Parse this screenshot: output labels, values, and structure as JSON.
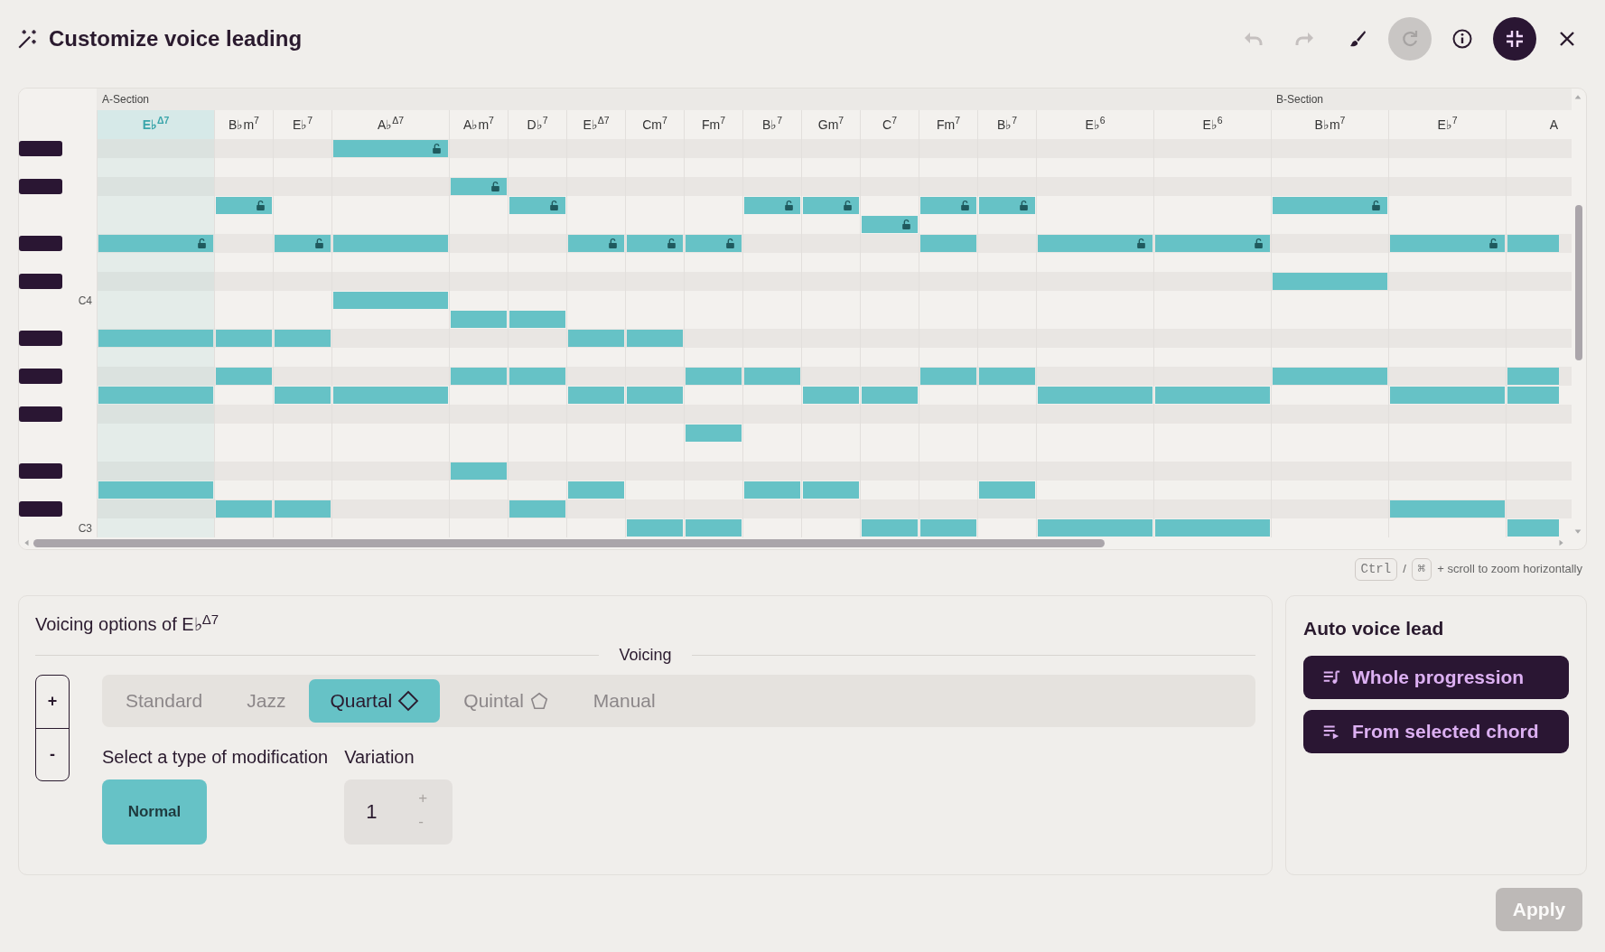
{
  "window": {
    "title": "Customize voice leading"
  },
  "toolbar": [
    {
      "kind": "undo",
      "disabled": true
    },
    {
      "kind": "redo",
      "disabled": true
    },
    {
      "kind": "brush",
      "disabled": false
    },
    {
      "kind": "refresh",
      "disabled": true
    },
    {
      "kind": "info",
      "disabled": false
    },
    {
      "kind": "collapse",
      "disabled": false
    },
    {
      "kind": "close",
      "disabled": false
    }
  ],
  "keyboard": [
    {
      "kind": "black_key"
    },
    {
      "kind": "white_key"
    },
    {
      "kind": "black_key"
    },
    {
      "kind": "white_key"
    },
    {
      "kind": "white_key"
    },
    {
      "kind": "black_key"
    },
    {
      "kind": "white_key"
    },
    {
      "kind": "black_key"
    },
    {
      "kind": "white_key",
      "label": "C4"
    },
    {
      "kind": "white_key"
    },
    {
      "kind": "black_key"
    },
    {
      "kind": "white_key"
    },
    {
      "kind": "black_key"
    },
    {
      "kind": "white_key"
    },
    {
      "kind": "black_key"
    },
    {
      "kind": "white_key"
    },
    {
      "kind": "white_key"
    },
    {
      "kind": "black_key"
    },
    {
      "kind": "white_key"
    },
    {
      "kind": "black_key"
    },
    {
      "kind": "white_key",
      "label": "C3"
    }
  ],
  "chords": [
    {
      "name": "E♭$^{Δ7}$",
      "kind": "wide",
      "selected": true,
      "section": "A-Section",
      "cells": [
        {
          "kind": "rest"
        },
        {
          "kind": "rest"
        },
        {
          "kind": "rest"
        },
        {
          "kind": "rest"
        },
        {
          "kind": "rest"
        },
        {
          "kind": "locked_note"
        },
        {
          "kind": "rest"
        },
        {
          "kind": "rest"
        },
        {
          "kind": "rest"
        },
        {
          "kind": "rest"
        },
        {
          "kind": "note"
        },
        {
          "kind": "rest"
        },
        {
          "kind": "rest"
        },
        {
          "kind": "note"
        },
        {
          "kind": "rest"
        },
        {
          "kind": "rest"
        },
        {
          "kind": "rest"
        },
        {
          "kind": "rest"
        },
        {
          "kind": "note"
        },
        {
          "kind": "rest"
        },
        {
          "kind": "rest"
        }
      ]
    },
    {
      "name": "B♭m$^{7}$",
      "kind": "narrow",
      "selected": false,
      "cells": [
        {
          "kind": "rest"
        },
        {
          "kind": "rest"
        },
        {
          "kind": "rest"
        },
        {
          "kind": "locked_note"
        },
        {
          "kind": "rest"
        },
        {
          "kind": "rest"
        },
        {
          "kind": "rest"
        },
        {
          "kind": "rest"
        },
        {
          "kind": "rest"
        },
        {
          "kind": "rest"
        },
        {
          "kind": "note"
        },
        {
          "kind": "rest"
        },
        {
          "kind": "note"
        },
        {
          "kind": "rest"
        },
        {
          "kind": "rest"
        },
        {
          "kind": "rest"
        },
        {
          "kind": "rest"
        },
        {
          "kind": "rest"
        },
        {
          "kind": "rest"
        },
        {
          "kind": "note"
        },
        {
          "kind": "rest"
        }
      ]
    },
    {
      "name": "E♭$^{7}$",
      "kind": "narrow",
      "selected": false,
      "cells": [
        {
          "kind": "rest"
        },
        {
          "kind": "rest"
        },
        {
          "kind": "rest"
        },
        {
          "kind": "rest"
        },
        {
          "kind": "rest"
        },
        {
          "kind": "locked_note"
        },
        {
          "kind": "rest"
        },
        {
          "kind": "rest"
        },
        {
          "kind": "rest"
        },
        {
          "kind": "rest"
        },
        {
          "kind": "note"
        },
        {
          "kind": "rest"
        },
        {
          "kind": "rest"
        },
        {
          "kind": "note"
        },
        {
          "kind": "rest"
        },
        {
          "kind": "rest"
        },
        {
          "kind": "rest"
        },
        {
          "kind": "rest"
        },
        {
          "kind": "rest"
        },
        {
          "kind": "note"
        },
        {
          "kind": "rest"
        }
      ]
    },
    {
      "name": "A♭$^{Δ7}$",
      "kind": "wide",
      "selected": false,
      "cells": [
        {
          "kind": "locked_note"
        },
        {
          "kind": "rest"
        },
        {
          "kind": "rest"
        },
        {
          "kind": "rest"
        },
        {
          "kind": "rest"
        },
        {
          "kind": "note"
        },
        {
          "kind": "rest"
        },
        {
          "kind": "rest"
        },
        {
          "kind": "note"
        },
        {
          "kind": "rest"
        },
        {
          "kind": "rest"
        },
        {
          "kind": "rest"
        },
        {
          "kind": "rest"
        },
        {
          "kind": "note"
        },
        {
          "kind": "rest"
        },
        {
          "kind": "rest"
        },
        {
          "kind": "rest"
        },
        {
          "kind": "rest"
        },
        {
          "kind": "rest"
        },
        {
          "kind": "rest"
        },
        {
          "kind": "rest"
        }
      ]
    },
    {
      "name": "A♭m$^{7}$",
      "kind": "narrow",
      "selected": false,
      "cells": [
        {
          "kind": "rest"
        },
        {
          "kind": "rest"
        },
        {
          "kind": "locked_note"
        },
        {
          "kind": "rest"
        },
        {
          "kind": "rest"
        },
        {
          "kind": "rest"
        },
        {
          "kind": "rest"
        },
        {
          "kind": "rest"
        },
        {
          "kind": "rest"
        },
        {
          "kind": "note"
        },
        {
          "kind": "rest"
        },
        {
          "kind": "rest"
        },
        {
          "kind": "note"
        },
        {
          "kind": "rest"
        },
        {
          "kind": "rest"
        },
        {
          "kind": "rest"
        },
        {
          "kind": "rest"
        },
        {
          "kind": "note"
        },
        {
          "kind": "rest"
        },
        {
          "kind": "rest"
        },
        {
          "kind": "rest"
        }
      ]
    },
    {
      "name": "D♭$^{7}$",
      "kind": "narrow",
      "selected": false,
      "cells": [
        {
          "kind": "rest"
        },
        {
          "kind": "rest"
        },
        {
          "kind": "rest"
        },
        {
          "kind": "locked_note"
        },
        {
          "kind": "rest"
        },
        {
          "kind": "rest"
        },
        {
          "kind": "rest"
        },
        {
          "kind": "rest"
        },
        {
          "kind": "rest"
        },
        {
          "kind": "note"
        },
        {
          "kind": "rest"
        },
        {
          "kind": "rest"
        },
        {
          "kind": "note"
        },
        {
          "kind": "rest"
        },
        {
          "kind": "rest"
        },
        {
          "kind": "rest"
        },
        {
          "kind": "rest"
        },
        {
          "kind": "rest"
        },
        {
          "kind": "rest"
        },
        {
          "kind": "note"
        },
        {
          "kind": "rest"
        }
      ]
    },
    {
      "name": "E♭$^{Δ7}$",
      "kind": "narrow",
      "selected": false,
      "cells": [
        {
          "kind": "rest"
        },
        {
          "kind": "rest"
        },
        {
          "kind": "rest"
        },
        {
          "kind": "rest"
        },
        {
          "kind": "rest"
        },
        {
          "kind": "locked_note"
        },
        {
          "kind": "rest"
        },
        {
          "kind": "rest"
        },
        {
          "kind": "rest"
        },
        {
          "kind": "rest"
        },
        {
          "kind": "note"
        },
        {
          "kind": "rest"
        },
        {
          "kind": "rest"
        },
        {
          "kind": "note"
        },
        {
          "kind": "rest"
        },
        {
          "kind": "rest"
        },
        {
          "kind": "rest"
        },
        {
          "kind": "rest"
        },
        {
          "kind": "note"
        },
        {
          "kind": "rest"
        },
        {
          "kind": "rest"
        }
      ]
    },
    {
      "name": "Cm$^{7}$",
      "kind": "narrow",
      "selected": false,
      "cells": [
        {
          "kind": "rest"
        },
        {
          "kind": "rest"
        },
        {
          "kind": "rest"
        },
        {
          "kind": "rest"
        },
        {
          "kind": "rest"
        },
        {
          "kind": "locked_note"
        },
        {
          "kind": "rest"
        },
        {
          "kind": "rest"
        },
        {
          "kind": "rest"
        },
        {
          "kind": "rest"
        },
        {
          "kind": "note"
        },
        {
          "kind": "rest"
        },
        {
          "kind": "rest"
        },
        {
          "kind": "note"
        },
        {
          "kind": "rest"
        },
        {
          "kind": "rest"
        },
        {
          "kind": "rest"
        },
        {
          "kind": "rest"
        },
        {
          "kind": "rest"
        },
        {
          "kind": "rest"
        },
        {
          "kind": "note"
        }
      ]
    },
    {
      "name": "Fm$^{7}$",
      "kind": "narrow",
      "selected": false,
      "cells": [
        {
          "kind": "rest"
        },
        {
          "kind": "rest"
        },
        {
          "kind": "rest"
        },
        {
          "kind": "rest"
        },
        {
          "kind": "rest"
        },
        {
          "kind": "locked_note"
        },
        {
          "kind": "rest"
        },
        {
          "kind": "rest"
        },
        {
          "kind": "rest"
        },
        {
          "kind": "rest"
        },
        {
          "kind": "rest"
        },
        {
          "kind": "rest"
        },
        {
          "kind": "note"
        },
        {
          "kind": "rest"
        },
        {
          "kind": "rest"
        },
        {
          "kind": "note"
        },
        {
          "kind": "rest"
        },
        {
          "kind": "rest"
        },
        {
          "kind": "rest"
        },
        {
          "kind": "rest"
        },
        {
          "kind": "note"
        }
      ]
    },
    {
      "name": "B♭$^{7}$",
      "kind": "narrow",
      "selected": false,
      "cells": [
        {
          "kind": "rest"
        },
        {
          "kind": "rest"
        },
        {
          "kind": "rest"
        },
        {
          "kind": "locked_note"
        },
        {
          "kind": "rest"
        },
        {
          "kind": "rest"
        },
        {
          "kind": "rest"
        },
        {
          "kind": "rest"
        },
        {
          "kind": "rest"
        },
        {
          "kind": "rest"
        },
        {
          "kind": "rest"
        },
        {
          "kind": "rest"
        },
        {
          "kind": "note"
        },
        {
          "kind": "rest"
        },
        {
          "kind": "rest"
        },
        {
          "kind": "rest"
        },
        {
          "kind": "rest"
        },
        {
          "kind": "rest"
        },
        {
          "kind": "note"
        },
        {
          "kind": "rest"
        },
        {
          "kind": "rest"
        }
      ]
    },
    {
      "name": "Gm$^{7}$",
      "kind": "narrow",
      "selected": false,
      "cells": [
        {
          "kind": "rest"
        },
        {
          "kind": "rest"
        },
        {
          "kind": "rest"
        },
        {
          "kind": "locked_note"
        },
        {
          "kind": "rest"
        },
        {
          "kind": "rest"
        },
        {
          "kind": "rest"
        },
        {
          "kind": "rest"
        },
        {
          "kind": "rest"
        },
        {
          "kind": "rest"
        },
        {
          "kind": "rest"
        },
        {
          "kind": "rest"
        },
        {
          "kind": "rest"
        },
        {
          "kind": "note"
        },
        {
          "kind": "rest"
        },
        {
          "kind": "rest"
        },
        {
          "kind": "rest"
        },
        {
          "kind": "rest"
        },
        {
          "kind": "note"
        },
        {
          "kind": "rest"
        },
        {
          "kind": "rest"
        }
      ]
    },
    {
      "name": "C$^{7}$",
      "kind": "narrow",
      "selected": false,
      "cells": [
        {
          "kind": "rest"
        },
        {
          "kind": "rest"
        },
        {
          "kind": "rest"
        },
        {
          "kind": "rest"
        },
        {
          "kind": "locked_note"
        },
        {
          "kind": "rest"
        },
        {
          "kind": "rest"
        },
        {
          "kind": "rest"
        },
        {
          "kind": "rest"
        },
        {
          "kind": "rest"
        },
        {
          "kind": "rest"
        },
        {
          "kind": "rest"
        },
        {
          "kind": "rest"
        },
        {
          "kind": "note"
        },
        {
          "kind": "rest"
        },
        {
          "kind": "rest"
        },
        {
          "kind": "rest"
        },
        {
          "kind": "rest"
        },
        {
          "kind": "rest"
        },
        {
          "kind": "rest"
        },
        {
          "kind": "note"
        }
      ]
    },
    {
      "name": "Fm$^{7}$",
      "kind": "narrow",
      "selected": false,
      "cells": [
        {
          "kind": "rest"
        },
        {
          "kind": "rest"
        },
        {
          "kind": "rest"
        },
        {
          "kind": "locked_note"
        },
        {
          "kind": "rest"
        },
        {
          "kind": "note"
        },
        {
          "kind": "rest"
        },
        {
          "kind": "rest"
        },
        {
          "kind": "rest"
        },
        {
          "kind": "rest"
        },
        {
          "kind": "rest"
        },
        {
          "kind": "rest"
        },
        {
          "kind": "note"
        },
        {
          "kind": "rest"
        },
        {
          "kind": "rest"
        },
        {
          "kind": "rest"
        },
        {
          "kind": "rest"
        },
        {
          "kind": "rest"
        },
        {
          "kind": "rest"
        },
        {
          "kind": "rest"
        },
        {
          "kind": "note"
        }
      ]
    },
    {
      "name": "B♭$^{7}$",
      "kind": "narrow",
      "selected": false,
      "cells": [
        {
          "kind": "rest"
        },
        {
          "kind": "rest"
        },
        {
          "kind": "rest"
        },
        {
          "kind": "locked_note"
        },
        {
          "kind": "rest"
        },
        {
          "kind": "rest"
        },
        {
          "kind": "rest"
        },
        {
          "kind": "rest"
        },
        {
          "kind": "rest"
        },
        {
          "kind": "rest"
        },
        {
          "kind": "rest"
        },
        {
          "kind": "rest"
        },
        {
          "kind": "note"
        },
        {
          "kind": "rest"
        },
        {
          "kind": "rest"
        },
        {
          "kind": "rest"
        },
        {
          "kind": "rest"
        },
        {
          "kind": "rest"
        },
        {
          "kind": "note"
        },
        {
          "kind": "rest"
        },
        {
          "kind": "rest"
        }
      ]
    },
    {
      "name": "E♭$^{6}$",
      "kind": "wide",
      "selected": false,
      "cells": [
        {
          "kind": "rest"
        },
        {
          "kind": "rest"
        },
        {
          "kind": "rest"
        },
        {
          "kind": "rest"
        },
        {
          "kind": "rest"
        },
        {
          "kind": "locked_note"
        },
        {
          "kind": "rest"
        },
        {
          "kind": "rest"
        },
        {
          "kind": "rest"
        },
        {
          "kind": "rest"
        },
        {
          "kind": "rest"
        },
        {
          "kind": "rest"
        },
        {
          "kind": "rest"
        },
        {
          "kind": "note"
        },
        {
          "kind": "rest"
        },
        {
          "kind": "rest"
        },
        {
          "kind": "rest"
        },
        {
          "kind": "rest"
        },
        {
          "kind": "rest"
        },
        {
          "kind": "rest"
        },
        {
          "kind": "note"
        }
      ]
    },
    {
      "name": "E♭$^{6}$",
      "kind": "wide",
      "selected": false,
      "cells": [
        {
          "kind": "rest"
        },
        {
          "kind": "rest"
        },
        {
          "kind": "rest"
        },
        {
          "kind": "rest"
        },
        {
          "kind": "rest"
        },
        {
          "kind": "locked_note"
        },
        {
          "kind": "rest"
        },
        {
          "kind": "rest"
        },
        {
          "kind": "rest"
        },
        {
          "kind": "rest"
        },
        {
          "kind": "rest"
        },
        {
          "kind": "rest"
        },
        {
          "kind": "rest"
        },
        {
          "kind": "note"
        },
        {
          "kind": "rest"
        },
        {
          "kind": "rest"
        },
        {
          "kind": "rest"
        },
        {
          "kind": "rest"
        },
        {
          "kind": "rest"
        },
        {
          "kind": "rest"
        },
        {
          "kind": "note"
        }
      ]
    },
    {
      "name": "B♭m$^{7}$",
      "kind": "wide",
      "selected": false,
      "section": "B-Section",
      "cells": [
        {
          "kind": "rest"
        },
        {
          "kind": "rest"
        },
        {
          "kind": "rest"
        },
        {
          "kind": "locked_note"
        },
        {
          "kind": "rest"
        },
        {
          "kind": "rest"
        },
        {
          "kind": "rest"
        },
        {
          "kind": "note"
        },
        {
          "kind": "rest"
        },
        {
          "kind": "rest"
        },
        {
          "kind": "rest"
        },
        {
          "kind": "rest"
        },
        {
          "kind": "note"
        },
        {
          "kind": "rest"
        },
        {
          "kind": "rest"
        },
        {
          "kind": "rest"
        },
        {
          "kind": "rest"
        },
        {
          "kind": "rest"
        },
        {
          "kind": "rest"
        },
        {
          "kind": "rest"
        },
        {
          "kind": "rest"
        }
      ]
    },
    {
      "name": "E♭$^{7}$",
      "kind": "wide",
      "selected": false,
      "cells": [
        {
          "kind": "rest"
        },
        {
          "kind": "rest"
        },
        {
          "kind": "rest"
        },
        {
          "kind": "rest"
        },
        {
          "kind": "rest"
        },
        {
          "kind": "locked_note"
        },
        {
          "kind": "rest"
        },
        {
          "kind": "rest"
        },
        {
          "kind": "rest"
        },
        {
          "kind": "rest"
        },
        {
          "kind": "rest"
        },
        {
          "kind": "rest"
        },
        {
          "kind": "rest"
        },
        {
          "kind": "note"
        },
        {
          "kind": "rest"
        },
        {
          "kind": "rest"
        },
        {
          "kind": "rest"
        },
        {
          "kind": "rest"
        },
        {
          "kind": "rest"
        },
        {
          "kind": "note"
        },
        {
          "kind": "rest"
        }
      ]
    },
    {
      "name": "A",
      "kind": "cut",
      "selected": false,
      "cells": [
        {
          "kind": "rest"
        },
        {
          "kind": "rest"
        },
        {
          "kind": "rest"
        },
        {
          "kind": "rest"
        },
        {
          "kind": "rest"
        },
        {
          "kind": "note"
        },
        {
          "kind": "rest"
        },
        {
          "kind": "rest"
        },
        {
          "kind": "rest"
        },
        {
          "kind": "rest"
        },
        {
          "kind": "rest"
        },
        {
          "kind": "rest"
        },
        {
          "kind": "note"
        },
        {
          "kind": "note"
        },
        {
          "kind": "rest"
        },
        {
          "kind": "rest"
        },
        {
          "kind": "rest"
        },
        {
          "kind": "rest"
        },
        {
          "kind": "rest"
        },
        {
          "kind": "rest"
        },
        {
          "kind": "note"
        }
      ]
    }
  ],
  "zoom_hint": {
    "keys": [
      "Ctrl",
      "⌘"
    ],
    "separator": "/",
    "text": "+ scroll to zoom horizontally"
  },
  "voicing_panel": {
    "title": "Voicing options of E♭$^{Δ7}$",
    "divider_label": "Voicing",
    "stepper": [
      "+",
      "-"
    ],
    "voicings": [
      {
        "label": "Standard",
        "kind": "plain",
        "selected": false
      },
      {
        "label": "Jazz",
        "kind": "plain",
        "selected": false
      },
      {
        "label": "Quartal",
        "kind": "diamond",
        "selected": true
      },
      {
        "label": "Quintal",
        "kind": "pentagon",
        "selected": false
      },
      {
        "label": "Manual",
        "kind": "plain",
        "selected": false
      }
    ],
    "modification_label": "Select a type of modification",
    "modifications": [
      {
        "label": "Normal",
        "selected": true
      }
    ],
    "variation_label": "Variation",
    "variation": {
      "value": "1",
      "buttons": [
        "+",
        "-"
      ]
    }
  },
  "auto_panel": {
    "title": "Auto voice lead",
    "buttons": [
      {
        "label": "Whole progression",
        "kind": "whole"
      },
      {
        "label": "From selected chord",
        "kind": "from"
      }
    ]
  },
  "apply": {
    "label": "Apply",
    "disabled": true
  }
}
